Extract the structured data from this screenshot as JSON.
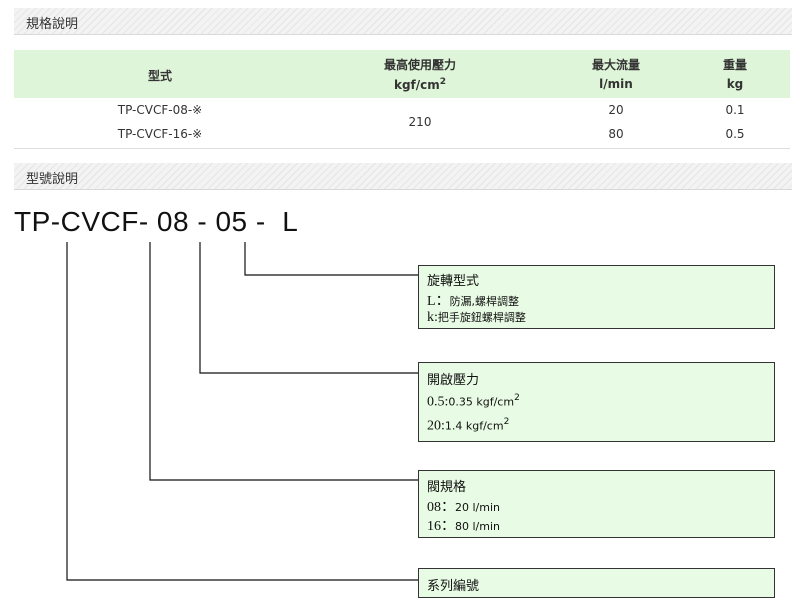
{
  "spec_section": {
    "title": "規格說明"
  },
  "spec_table": {
    "headers": {
      "model": "型式",
      "pressure": "最高使用壓力",
      "pressure_unit_base": "kgf/cm",
      "pressure_unit_sup": "2",
      "flow": "最大流量",
      "flow_unit": "l/min",
      "weight": "重量",
      "weight_unit": "kg"
    },
    "rows": [
      {
        "model": "TP-CVCF-08-※",
        "flow": "20",
        "weight": "0.1"
      },
      {
        "model": "TP-CVCF-16-※",
        "flow": "80",
        "weight": "0.5"
      }
    ],
    "shared_pressure": "210"
  },
  "code_section": {
    "title": "型號說明"
  },
  "model_code": "TP-CVCF- 08 - 05 -  L",
  "boxes": {
    "rotation": {
      "title": "旋轉型式",
      "line1_key": "L",
      "line1_sep": "：",
      "line1_desc": "防漏,螺桿調整",
      "line2_key": "k",
      "line2_sep": ":",
      "line2_desc": "把手旋鈕螺桿調整"
    },
    "cracking": {
      "title": "開啟壓力",
      "line1_key": "0.5",
      "line1_sep": ":",
      "line1_desc": "0.35 kgf/cm",
      "line1_sup": "2",
      "line2_key": "20",
      "line2_sep": ":",
      "line2_desc": "1.4 kgf/cm",
      "line2_sup": "2"
    },
    "size": {
      "title": "閥規格",
      "line1_key": "08",
      "line1_sep": "：",
      "line1_desc": "20 l/min",
      "line2_key": "16",
      "line2_sep": "：",
      "line2_desc": "80 l/min"
    },
    "series": {
      "title": "系列編號"
    }
  }
}
